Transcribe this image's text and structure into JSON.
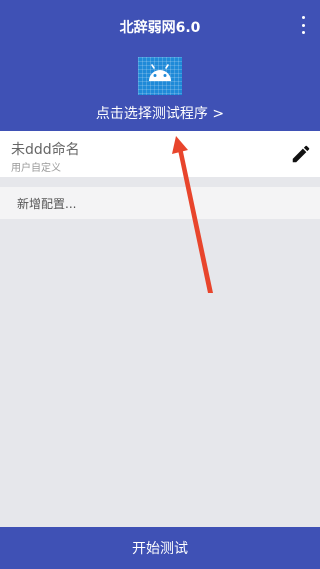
{
  "header": {
    "title": "北辞弱网6.0",
    "more_icon": "more-vertical-icon",
    "app_icon": "android-icon",
    "select_program_label": "点击选择测试程序 >",
    "background_color": "#3f51b5"
  },
  "config": {
    "name": "未ddd命名",
    "type": "用户自定义",
    "edit_icon": "pencil-icon"
  },
  "add_config_label": "新增配置...",
  "start_button_label": "开始测试",
  "annotation_arrow_color": "#e8452c"
}
